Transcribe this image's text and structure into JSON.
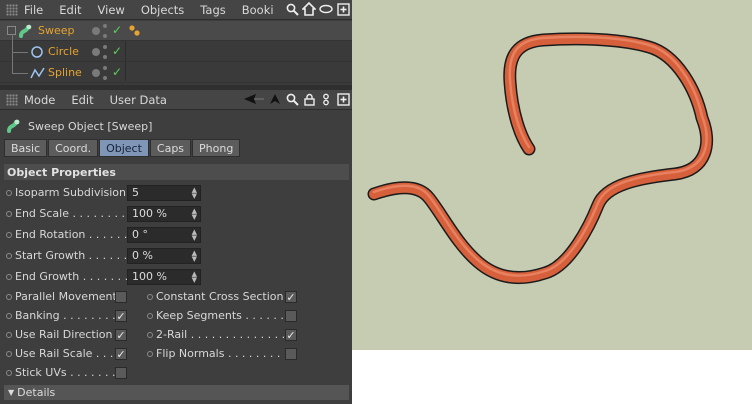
{
  "menubar": {
    "items": [
      "File",
      "Edit",
      "View",
      "Objects",
      "Tags",
      "Booki"
    ]
  },
  "objects": [
    {
      "name": "Sweep",
      "color": "#e7a32e"
    },
    {
      "name": "Circle",
      "color": "#e7a32e"
    },
    {
      "name": "Spline",
      "color": "#e7a32e"
    }
  ],
  "attrbar": {
    "items": [
      "Mode",
      "Edit",
      "User Data"
    ]
  },
  "attr_title": "Sweep Object [Sweep]",
  "tabs": [
    "Basic",
    "Coord.",
    "Object",
    "Caps",
    "Phong"
  ],
  "active_tab": "Object",
  "section": "Object Properties",
  "numeric_props": [
    {
      "label": "Isoparm Subdivision",
      "value": "5"
    },
    {
      "label": "End Scale . . . . . . . . .",
      "value": "100 %"
    },
    {
      "label": "End Rotation . . . . . .",
      "value": "0 °"
    },
    {
      "label": "Start Growth . . . . . .",
      "value": "0 %"
    },
    {
      "label": "End Growth . . . . . . .",
      "value": "100 %"
    }
  ],
  "checks_left": [
    {
      "label": "Parallel Movement",
      "checked": false
    },
    {
      "label": "Banking . . . . . . . . .",
      "checked": true
    },
    {
      "label": "Use Rail Direction",
      "checked": true
    },
    {
      "label": "Use Rail Scale . . . .",
      "checked": true
    },
    {
      "label": "Stick UVs . . . . . . . .",
      "checked": false
    }
  ],
  "checks_right": [
    {
      "label": "Constant Cross Section",
      "checked": true
    },
    {
      "label": "Keep Segments . . . . . . .",
      "checked": false
    },
    {
      "label": "2-Rail . . . . . . . . . . . . . . .",
      "checked": true
    },
    {
      "label": "Flip Normals . . . . . . . . .",
      "checked": false
    }
  ],
  "details_label": "Details",
  "icons": {
    "menubar": [
      "search-icon",
      "home-icon",
      "eye-icon",
      "new-window-icon"
    ],
    "attrbar": [
      "back-arrow-icon",
      "forward-arrow-icon",
      "search-icon",
      "lock-icon",
      "settings-icon",
      "new-window-icon"
    ],
    "objects": [
      "sweep-object-icon",
      "circle-spline-icon",
      "spline-icon"
    ]
  },
  "colors": {
    "panel_bg": "#3e3e3e",
    "viewport_bg": "#c5ccb1",
    "sweep_tube": "#d6603c",
    "active_tab": "#7f96b6",
    "object_name": "#e7a32e",
    "check_green": "#5bd05b"
  }
}
